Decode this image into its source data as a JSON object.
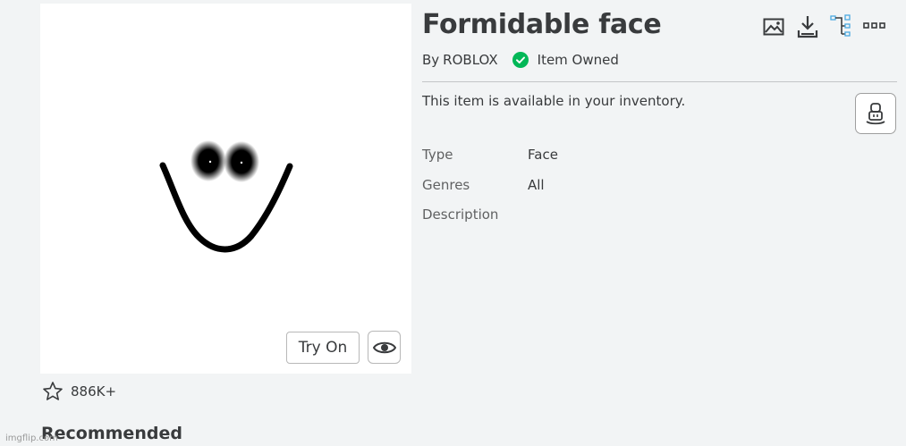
{
  "item": {
    "title": "Formidable face",
    "by_prefix": "By",
    "creator": "ROBLOX",
    "owned_status": "Item Owned",
    "availability": "This item is available in your inventory."
  },
  "details": {
    "type_label": "Type",
    "type_value": "Face",
    "genres_label": "Genres",
    "genres_value": "All",
    "description_label": "Description"
  },
  "thumbnail": {
    "try_on_label": "Try On"
  },
  "favorites": {
    "count": "886K+"
  },
  "sections": {
    "recommended": "Recommended"
  },
  "watermark": "imgflip.com",
  "toolbar_icons": [
    "image-icon",
    "download-icon",
    "hierarchy-icon",
    "more-icon"
  ],
  "colors": {
    "owned_check": "#02b757",
    "hierarchy_accent": "#4aa9e0",
    "text": "#393b3d",
    "background": "#f2f4f5"
  }
}
